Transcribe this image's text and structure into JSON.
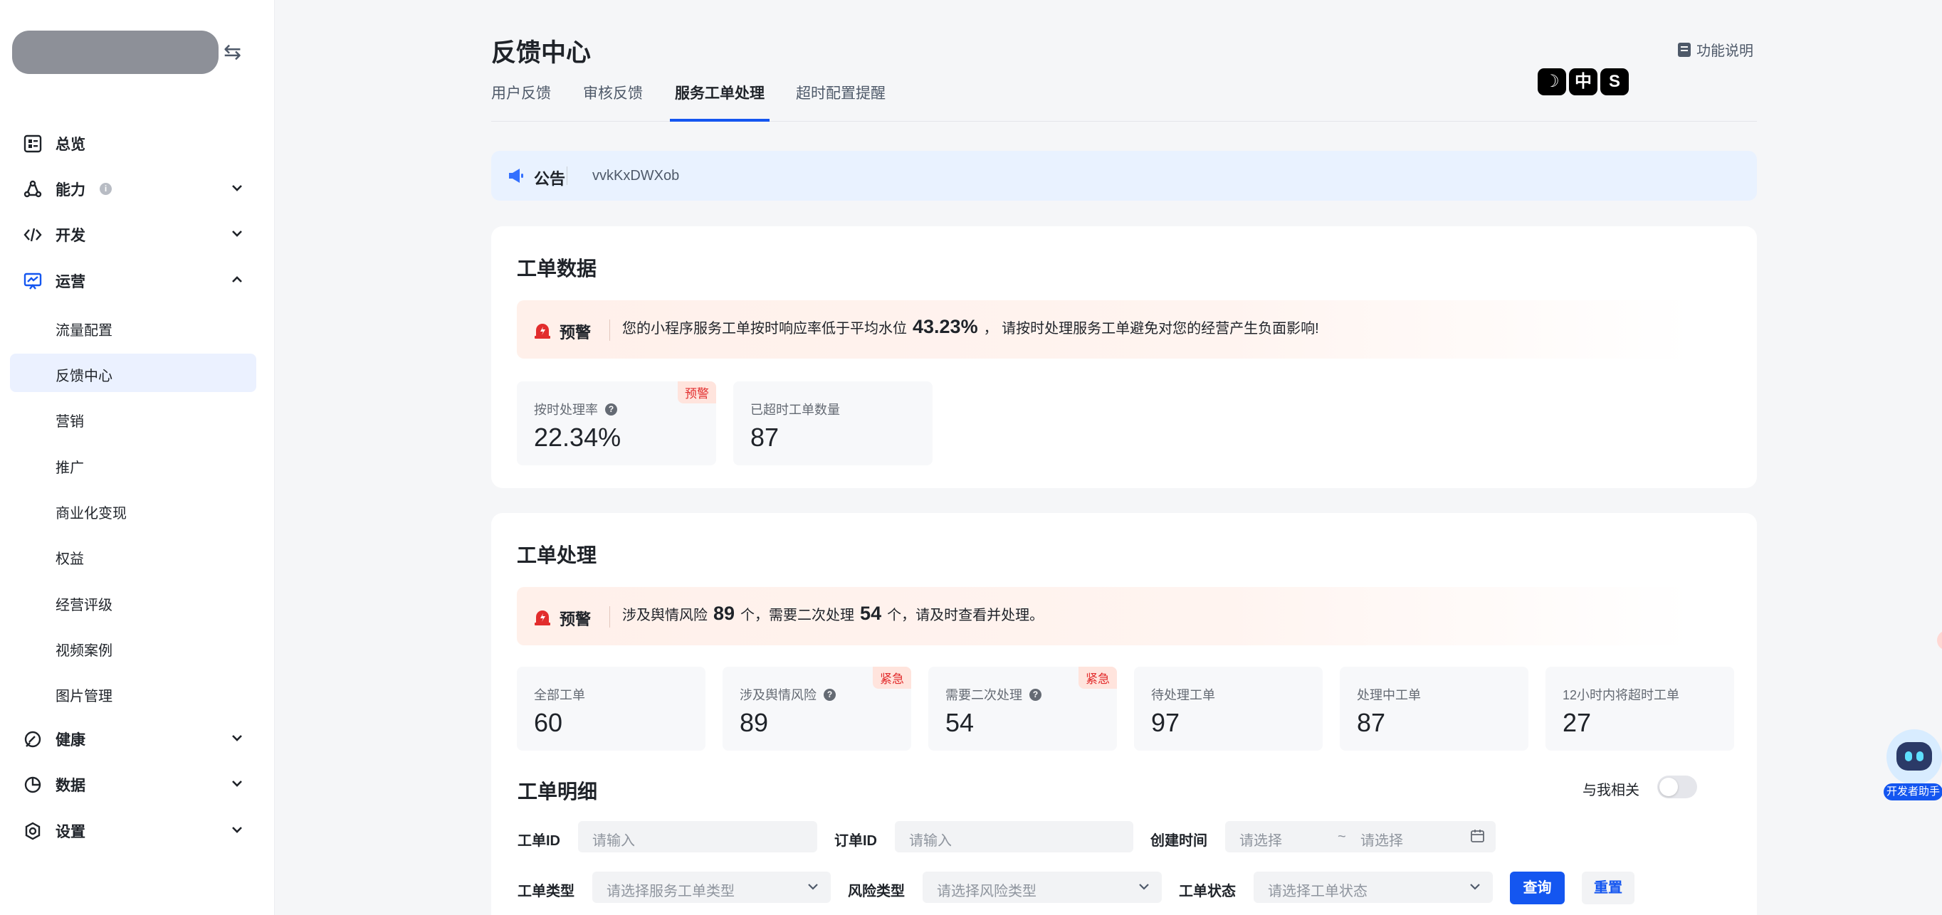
{
  "sidebar": {
    "items": [
      {
        "label": "总览",
        "icon": "overview-icon"
      },
      {
        "label": "能力",
        "icon": "ability-icon"
      },
      {
        "label": "开发",
        "icon": "code-icon"
      },
      {
        "label": "运营",
        "icon": "operation-icon"
      },
      {
        "label": "健康",
        "icon": "health-icon"
      },
      {
        "label": "数据",
        "icon": "data-icon"
      },
      {
        "label": "设置",
        "icon": "settings-icon"
      }
    ],
    "sub_items": [
      "流量配置",
      "反馈中心",
      "营销",
      "推广",
      "商业化变现",
      "权益",
      "经营评级",
      "视频案例",
      "图片管理"
    ],
    "active_sub": "反馈中心"
  },
  "header": {
    "title": "反馈中心",
    "help_label": "功能说明",
    "tabs": [
      "用户反馈",
      "审核反馈",
      "服务工单处理",
      "超时配置提醒"
    ],
    "active_tab": "服务工单处理",
    "badges": [
      "☽",
      "中",
      "S"
    ]
  },
  "notice": {
    "title": "公告",
    "text": "vvkKxDWXob"
  },
  "ticket_data": {
    "title": "工单数据",
    "warning": {
      "label": "预警",
      "text_before": "您的小程序服务工单按时响应率低于平均水位",
      "value": "43.23%",
      "text_after": "，  请按时处理服务工单避免对您的经营产生负面影响!"
    },
    "stats": [
      {
        "label": "按时处理率",
        "value": "22.34%",
        "tag": "预警"
      },
      {
        "label": "已超时工单数量",
        "value": "87"
      }
    ]
  },
  "ticket_process": {
    "title": "工单处理",
    "warning": {
      "label": "预警",
      "part1": "涉及舆情风险",
      "value1": "89",
      "part2": "个，需要二次处理",
      "value2": "54",
      "part3": "个，请及时查看并处理。"
    },
    "stats": [
      {
        "label": "全部工单",
        "value": "60"
      },
      {
        "label": "涉及舆情风险",
        "value": "89",
        "tag": "紧急"
      },
      {
        "label": "需要二次处理",
        "value": "54",
        "tag": "紧急"
      },
      {
        "label": "待处理工单",
        "value": "97"
      },
      {
        "label": "处理中工单",
        "value": "87"
      },
      {
        "label": "12小时内将超时工单",
        "value": "27"
      }
    ]
  },
  "ticket_detail": {
    "title": "工单明细",
    "toggle_label": "与我相关",
    "filters": {
      "ticket_id_label": "工单ID",
      "ticket_id_placeholder": "请输入",
      "order_id_label": "订单ID",
      "order_id_placeholder": "请输入",
      "created_label": "创建时间",
      "start_placeholder": "请选择",
      "range_sep": "~",
      "end_placeholder": "请选择",
      "type_label": "工单类型",
      "type_placeholder": "请选择服务工单类型",
      "risk_label": "风险类型",
      "risk_placeholder": "请选择风险类型",
      "status_label": "工单状态",
      "status_placeholder": "请选择工单状态"
    },
    "query_label": "查询",
    "reset_label": "重置"
  },
  "assistant": {
    "label": "开发者助手"
  },
  "colors": {
    "accent": "#1456f0",
    "warning_red": "#e22d2d",
    "active_bg": "#ebf1ff"
  }
}
